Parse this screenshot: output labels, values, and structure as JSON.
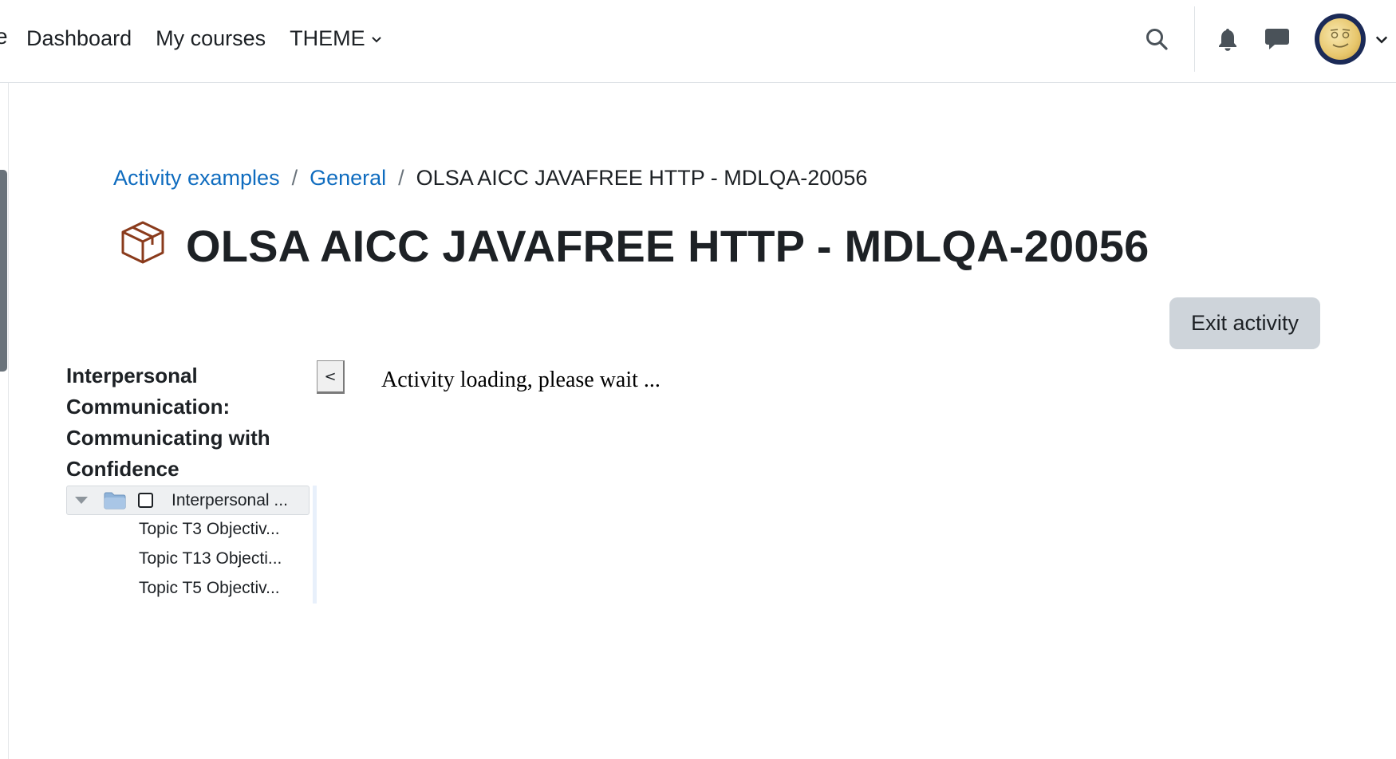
{
  "navbar": {
    "clipped_text": "e",
    "links": [
      {
        "label": "Dashboard"
      },
      {
        "label": "My courses"
      },
      {
        "label": "THEME"
      }
    ],
    "icons": [
      "search-icon",
      "bell-icon",
      "chat-icon",
      "avatar",
      "chevron-down-icon"
    ]
  },
  "breadcrumb": {
    "items": [
      "Activity examples",
      "General"
    ],
    "separator": "/",
    "current": "OLSA AICC JAVAFREE HTTP - MDLQA-20056"
  },
  "page": {
    "title": "OLSA AICC JAVAFREE HTTP - MDLQA-20056",
    "title_icon": "package-box-icon",
    "exit_label": "Exit activity"
  },
  "toc": {
    "title": "Interpersonal Communication: Communicating with Confidence",
    "root_label": "Interpersonal ...",
    "children": [
      "Topic T3 Objectiv...",
      "Topic T13 Objecti...",
      "Topic T5 Objectiv..."
    ],
    "collapse_label": "<"
  },
  "content": {
    "loading_text": "Activity loading, please wait ..."
  },
  "colors": {
    "link": "#0f6cbf",
    "text": "#1d2125",
    "exit_bg": "#ced4da",
    "icon_brown": "#8a3b1c"
  }
}
